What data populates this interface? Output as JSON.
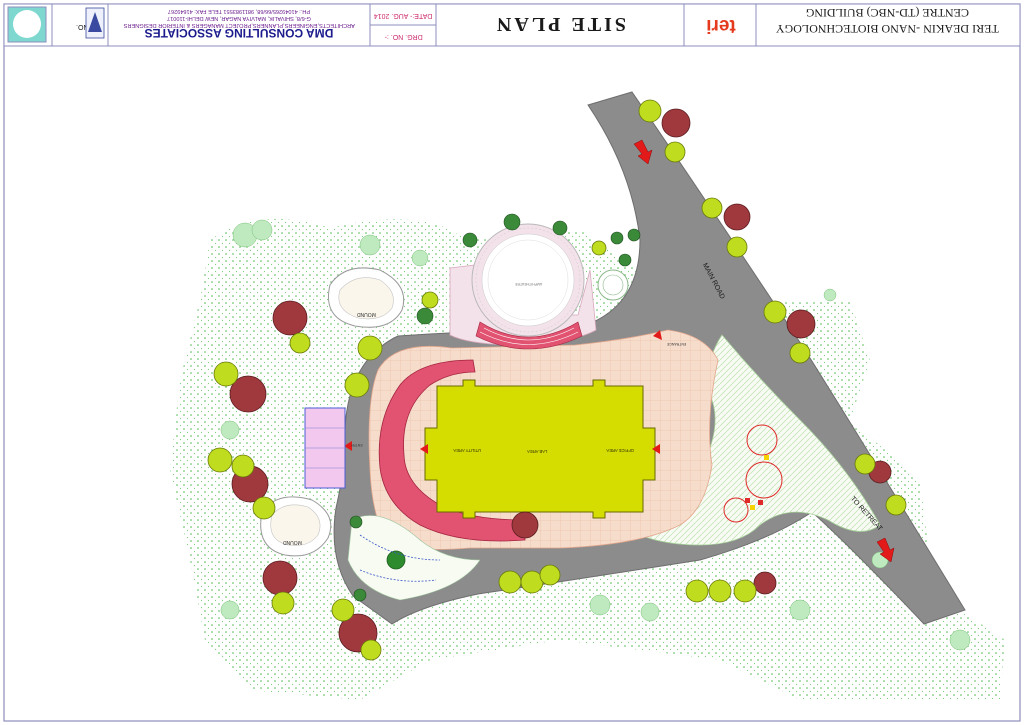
{
  "title_block": {
    "project_line1": "TERI DEAKIN -NANO BIOTECHNOLOGY",
    "project_line2": "CENTRE (TD-NBC) BUILDING",
    "logo_text": "teri",
    "sheet_title": "SITE PLAN",
    "date": "DATE:- AUG. 2014",
    "drg_no": "DRG. NO. :-",
    "firm_name": "DMA CONSULTING ASSOCIATES",
    "firm_desc": "ARCHITECTS,ENGINEERS,PLANNERS,PROJECT MANAGERS & INTERIOR DESIGNERS",
    "firm_address": "G-6/8, SHIVALIK, MALVIYA NAGAR, NEW DELHI-110017",
    "firm_phone": "PH.: 41049265/66/68, 9811983551 TELE FAX: 41649267",
    "job_no": "JOB NO."
  },
  "plan_labels": {
    "main_road": "MAIN ROAD",
    "to_retreat": "TO RETREAT",
    "lab_area": "LAB AREA",
    "office_area": "OFFICE AREA",
    "utility_area": "UTILITY AREA",
    "mound_top": "MOUND",
    "mound_bottom": "MOUND",
    "entrance": "ENTRANCE",
    "entry": "ENTRY",
    "amphitheatre": "AMPHITHEATRE"
  },
  "colors": {
    "road": "#8c8c8c",
    "building": "#d4dc00",
    "paving": "#f6dccb",
    "greenery": "#3ea83e",
    "tree_red": "#a0393e",
    "tree_yellow": "#bfdc1f",
    "ring": "#e25372",
    "title_text": "#1a1a1a",
    "firm_text": "#1a1a8c"
  }
}
